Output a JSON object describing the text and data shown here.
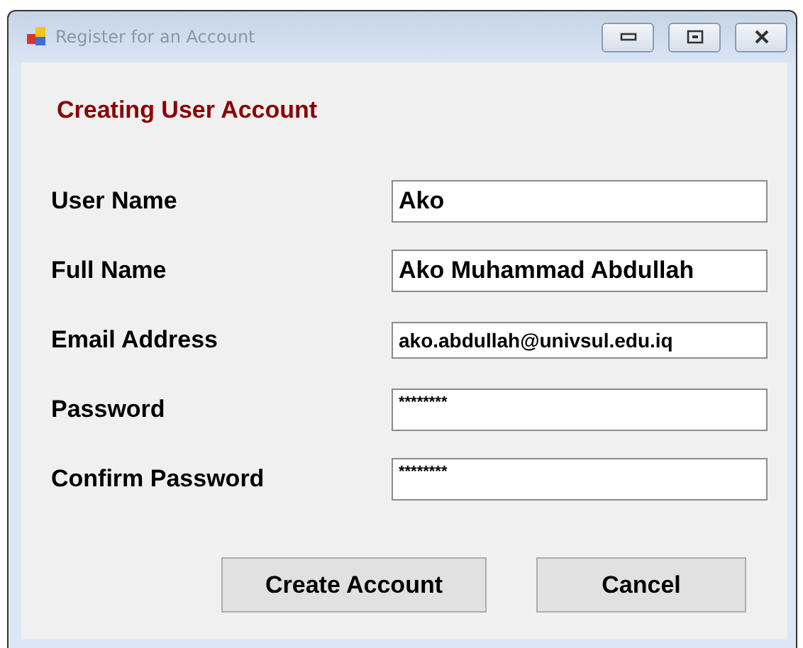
{
  "window": {
    "title": "Register for an Account"
  },
  "heading": "Creating User Account",
  "fields": [
    {
      "label": "User Name",
      "value": "Ako",
      "kind": "text"
    },
    {
      "label": "Full Name",
      "value": "Ako Muhammad Abdullah",
      "kind": "text"
    },
    {
      "label": "Email Address",
      "value": "ako.abdullah@univsul.edu.iq",
      "kind": "small"
    },
    {
      "label": "Password",
      "value": "********",
      "kind": "password"
    },
    {
      "label": "Confirm Password",
      "value": "********",
      "kind": "password"
    }
  ],
  "buttons": [
    "Create Account",
    "Cancel"
  ]
}
